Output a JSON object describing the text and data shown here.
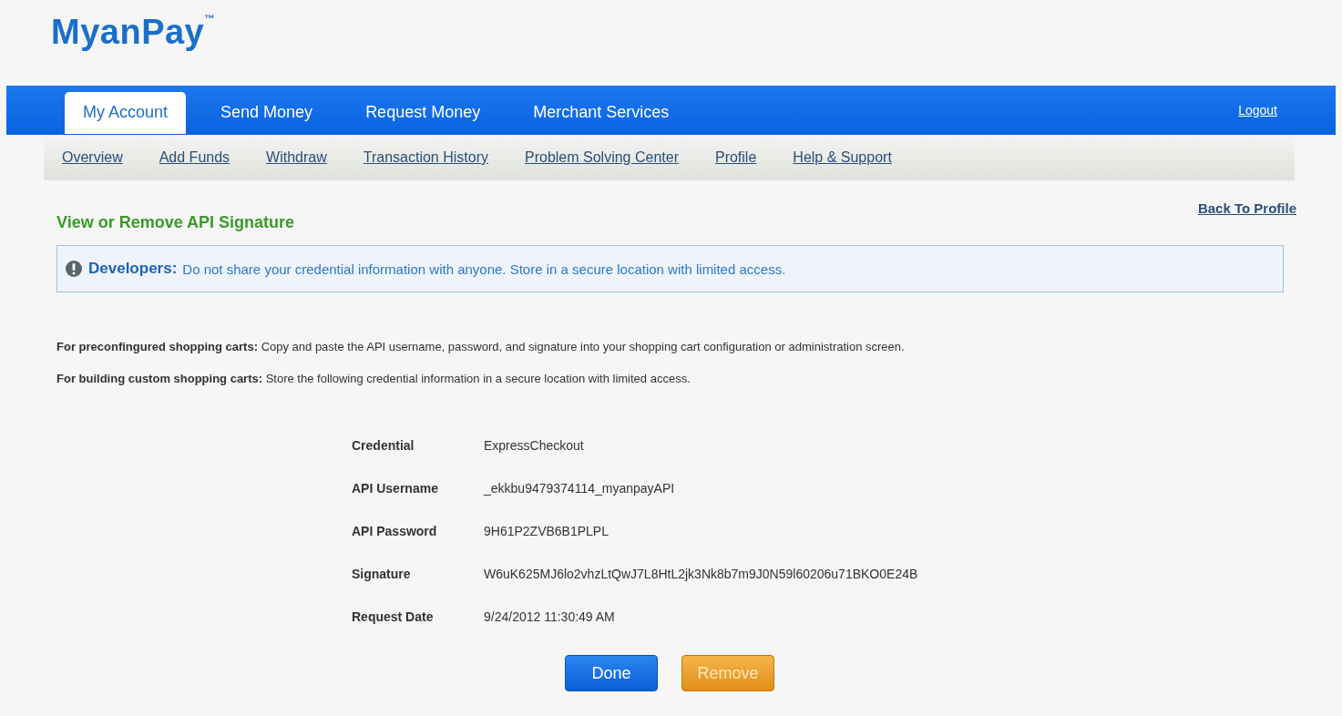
{
  "logo": "MyanPay$^{™}$",
  "tabs": [
    {
      "label": "My Account",
      "selected": true
    },
    {
      "label": "Send Money",
      "selected": false
    },
    {
      "label": "Request Money",
      "selected": false
    },
    {
      "label": "Merchant Services",
      "selected": false
    }
  ],
  "logout": "Logout",
  "subnav": [
    "Overview",
    "Add Funds",
    "Withdraw",
    "Transaction History",
    "Problem Solving Center",
    "Profile",
    "Help & Support"
  ],
  "page_title": "View or Remove API Signature",
  "back_link": "Back To Profile",
  "notice": {
    "label": "Developers:",
    "text": "Do not share your credential information with anyone. Store in a secure location with limited access."
  },
  "paragraphs": [
    "**For preconfingured shopping carts:** Copy and paste the API username, password, and signature into your shopping cart configuration or administration screen.",
    "**For building custom shopping carts:** Store the following credential information in a secure location with limited access."
  ],
  "details": [
    {
      "label": "Credential",
      "value": "ExpressCheckout"
    },
    {
      "label": "API Username",
      "value": "_ekkbu9479374114_myanpayAPI"
    },
    {
      "label": "API Password",
      "value": "9H61P2ZVB6B1PLPL"
    },
    {
      "label": "Signature",
      "value": "W6uK625MJ6lo2vhzLtQwJ7L8HtL2jk3Nk8b7m9J0N59l60206u71BKO0E24B"
    },
    {
      "label": "Request Date",
      "value": "9/24/2012 11:30:49 AM"
    }
  ],
  "buttons": [
    {
      "label": "Done",
      "kind": "primary"
    },
    {
      "label": "Remove",
      "kind": "secondary"
    }
  ]
}
